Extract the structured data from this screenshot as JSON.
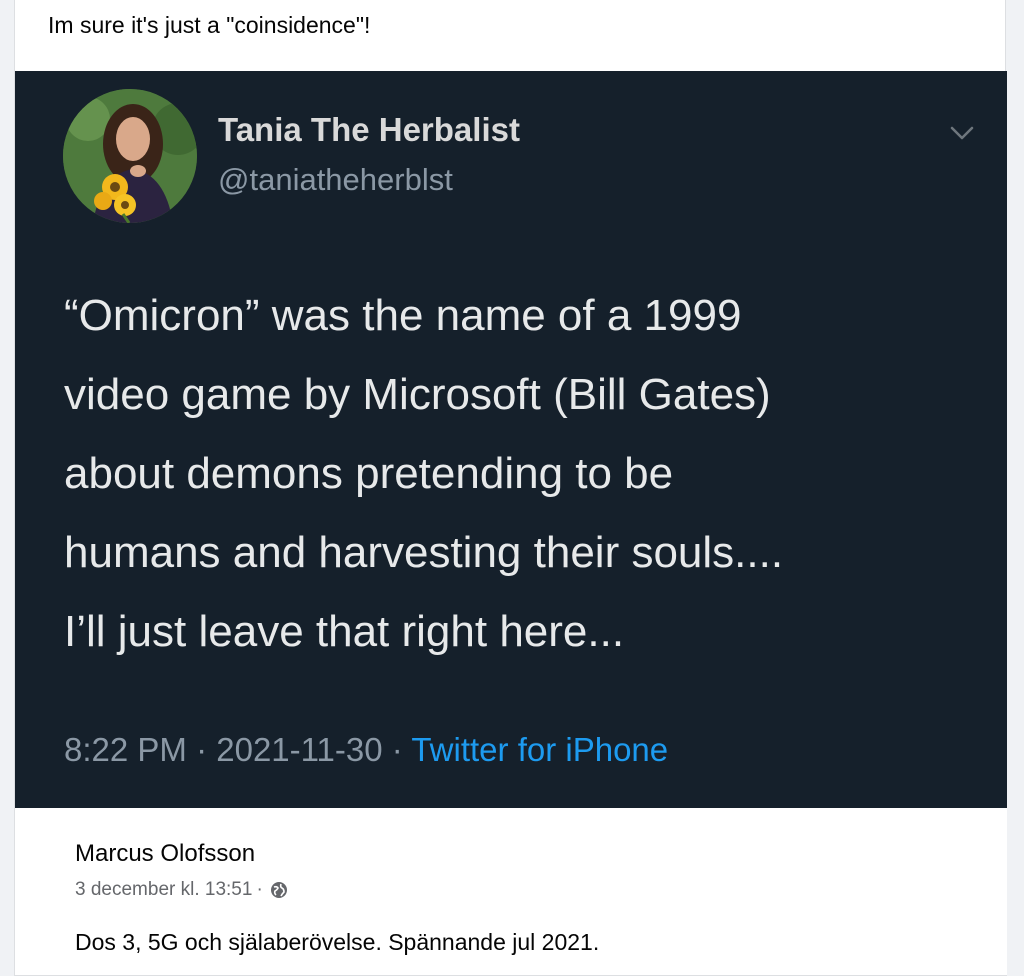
{
  "post": {
    "caption": "Im sure it's just a \"coinsidence\"!"
  },
  "tweet": {
    "author_name": "Tania The Herbalist",
    "author_handle": "@taniatheherblst",
    "text_lines": [
      "“Omicron” was the name of a 1999",
      "video game by Microsoft (Bill Gates)",
      "about demons pretending to be",
      "humans and harvesting their souls....",
      "I’ll just leave that right here..."
    ],
    "time": "8:22 PM",
    "date": "2021-11-30",
    "separator": "·",
    "source": "Twitter for iPhone",
    "menu_icon": "chevron-down-icon",
    "colors": {
      "background": "#15202b",
      "text": "#e7e9ea",
      "secondary": "#8b98a5",
      "link": "#1d9bf0"
    }
  },
  "comment": {
    "author_name": "Marcus Olofsson",
    "timestamp": "3 december kl. 13:51",
    "separator": "·",
    "privacy_icon": "globe-icon",
    "text": "Dos 3, 5G och själaberövelse. Spännande jul 2021."
  }
}
